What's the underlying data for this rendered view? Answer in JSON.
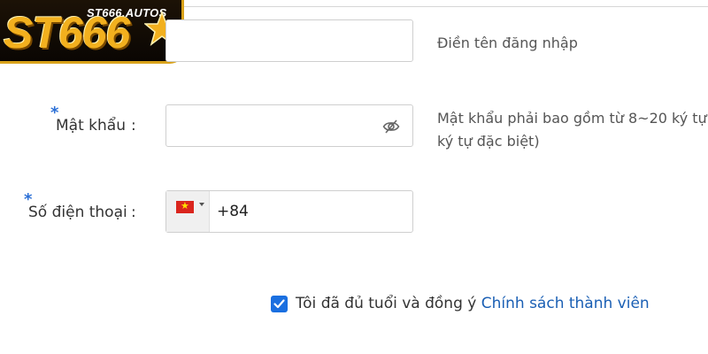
{
  "logo": {
    "domain": "ST666.AUTOS",
    "mark": "ST666",
    "colors": {
      "gold": "#f2b01e",
      "dark": "#0a0603"
    }
  },
  "form": {
    "username": {
      "hint": "Điền tên đăng nhập"
    },
    "password": {
      "required_marker": "*",
      "label": "Mật khẩu",
      "colon": ":",
      "icon": "eye-off-icon",
      "hint_line1": "Mật khẩu phải bao gồm từ 8~20 ký tự",
      "hint_line2": "ký tự đặc biệt)"
    },
    "phone": {
      "required_marker": "*",
      "label": "Số điện thoại",
      "colon": ":",
      "country_flag": "vietnam-flag-icon",
      "value": "+84"
    },
    "agreement": {
      "checked": true,
      "text": "Tôi đã đủ tuổi và đồng ý",
      "link": "Chính sách thành viên"
    }
  },
  "colors": {
    "accent_blue": "#1a6fe0",
    "link_blue": "#1a5fb4",
    "required_blue": "#2b6fd6",
    "border": "#cfcfcf"
  }
}
